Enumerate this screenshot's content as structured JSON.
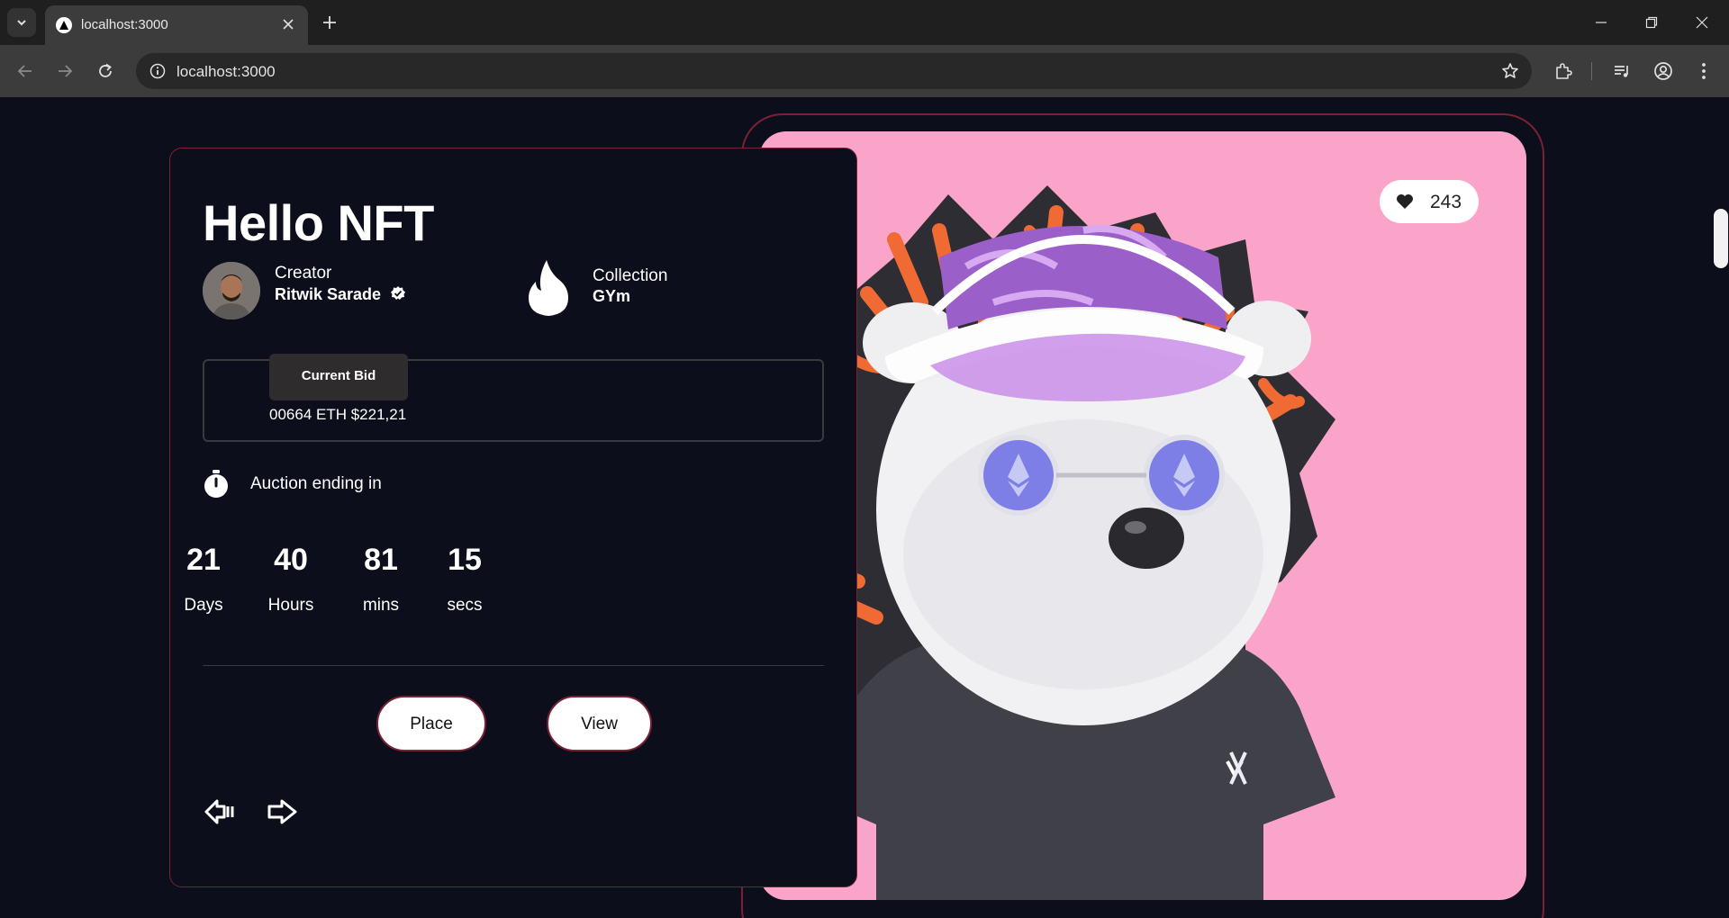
{
  "browser": {
    "tab_title": "localhost:3000",
    "url": "localhost:3000"
  },
  "nft": {
    "title": "Hello NFT",
    "creator_label": "Creator",
    "creator_name": "Ritwik Sarade",
    "collection_label": "Collection",
    "collection_name": "GYm",
    "bid_label": "Current Bid",
    "bid_value": "00664 ETH $221,21",
    "auction_label": "Auction ending in",
    "likes": "243"
  },
  "countdown": [
    {
      "value": "21",
      "unit": "Days"
    },
    {
      "value": "40",
      "unit": "Hours"
    },
    {
      "value": "81",
      "unit": "mins"
    },
    {
      "value": "15",
      "unit": "secs"
    }
  ],
  "buttons": {
    "place": "Place",
    "view": "View"
  },
  "colors": {
    "page_bg": "#0c0f1b",
    "accent_border": "#7a2233",
    "image_bg": "#fba4ca"
  }
}
